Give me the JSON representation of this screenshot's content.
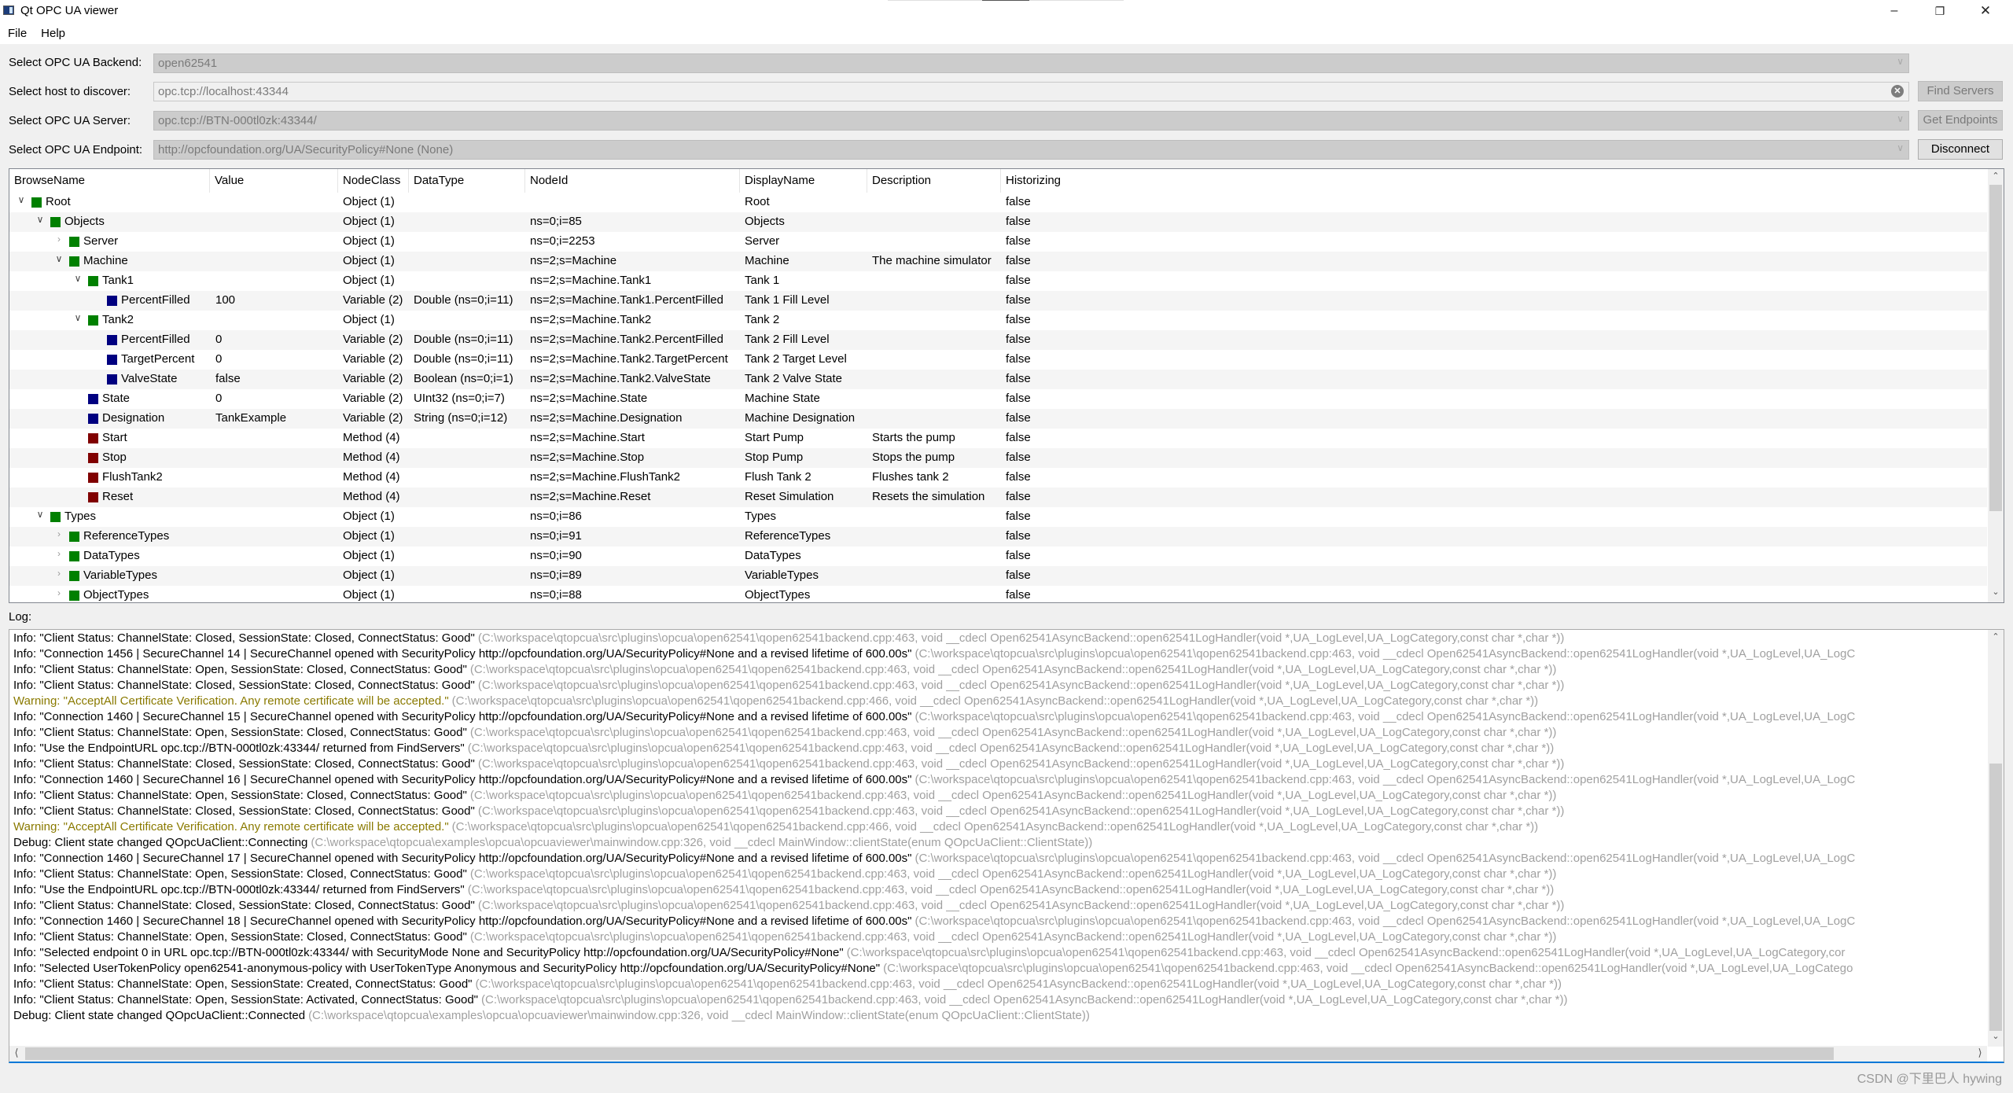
{
  "window": {
    "title": "Qt OPC UA viewer",
    "controls": {
      "minimize": "–",
      "maximize": "❐",
      "close": "✕"
    }
  },
  "menu": [
    "File",
    "Help"
  ],
  "form": {
    "backend": {
      "label": "Select OPC UA Backend:",
      "value": "open62541"
    },
    "host": {
      "label": "Select host to discover:",
      "value": "opc.tcp://localhost:43344"
    },
    "server": {
      "label": "Select OPC UA Server:",
      "value": "opc.tcp://BTN-000tl0zk:43344/"
    },
    "endpoint": {
      "label": "Select OPC UA Endpoint:",
      "value": "http://opcfoundation.org/UA/SecurityPolicy#None (None)"
    },
    "buttons": {
      "find_servers": "Find Servers",
      "get_endpoints": "Get Endpoints",
      "disconnect": "Disconnect"
    }
  },
  "colors": {
    "object_icon": "#008000",
    "variable_icon": "#000080",
    "method_icon": "#800000",
    "warning_text": "#8a7a00",
    "source_text": "#a0a0a0",
    "accent": "#0078d7"
  },
  "tree": {
    "columns": [
      "BrowseName",
      "Value",
      "NodeClass",
      "DataType",
      "NodeId",
      "DisplayName",
      "Description",
      "Historizing"
    ],
    "scroll_position": 0.0,
    "rows": [
      {
        "depth": 0,
        "expander": "expanded",
        "icon": "object",
        "browse_name": "Root",
        "value": "",
        "node_class": "Object (1)",
        "data_type": "",
        "node_id": "",
        "display_name": "Root",
        "description": "",
        "historizing": "false"
      },
      {
        "depth": 1,
        "expander": "expanded",
        "icon": "object",
        "browse_name": "Objects",
        "value": "",
        "node_class": "Object (1)",
        "data_type": "",
        "node_id": "ns=0;i=85",
        "display_name": "Objects",
        "description": "",
        "historizing": "false"
      },
      {
        "depth": 2,
        "expander": "collapsed",
        "icon": "object",
        "browse_name": "Server",
        "value": "",
        "node_class": "Object (1)",
        "data_type": "",
        "node_id": "ns=0;i=2253",
        "display_name": "Server",
        "description": "",
        "historizing": "false"
      },
      {
        "depth": 2,
        "expander": "expanded",
        "icon": "object",
        "browse_name": "Machine",
        "value": "",
        "node_class": "Object (1)",
        "data_type": "",
        "node_id": "ns=2;s=Machine",
        "display_name": "Machine",
        "description": "The machine simulator",
        "historizing": "false"
      },
      {
        "depth": 3,
        "expander": "expanded",
        "icon": "object",
        "browse_name": "Tank1",
        "value": "",
        "node_class": "Object (1)",
        "data_type": "",
        "node_id": "ns=2;s=Machine.Tank1",
        "display_name": "Tank 1",
        "description": "",
        "historizing": "false"
      },
      {
        "depth": 4,
        "expander": "none",
        "icon": "variable",
        "browse_name": "PercentFilled",
        "value": "100",
        "node_class": "Variable (2)",
        "data_type": "Double (ns=0;i=11)",
        "node_id": "ns=2;s=Machine.Tank1.PercentFilled",
        "display_name": "Tank 1 Fill Level",
        "description": "",
        "historizing": "false"
      },
      {
        "depth": 3,
        "expander": "expanded",
        "icon": "object",
        "browse_name": "Tank2",
        "value": "",
        "node_class": "Object (1)",
        "data_type": "",
        "node_id": "ns=2;s=Machine.Tank2",
        "display_name": "Tank 2",
        "description": "",
        "historizing": "false"
      },
      {
        "depth": 4,
        "expander": "none",
        "icon": "variable",
        "browse_name": "PercentFilled",
        "value": "0",
        "node_class": "Variable (2)",
        "data_type": "Double (ns=0;i=11)",
        "node_id": "ns=2;s=Machine.Tank2.PercentFilled",
        "display_name": "Tank 2 Fill Level",
        "description": "",
        "historizing": "false"
      },
      {
        "depth": 4,
        "expander": "none",
        "icon": "variable",
        "browse_name": "TargetPercent",
        "value": "0",
        "node_class": "Variable (2)",
        "data_type": "Double (ns=0;i=11)",
        "node_id": "ns=2;s=Machine.Tank2.TargetPercent",
        "display_name": "Tank 2 Target Level",
        "description": "",
        "historizing": "false"
      },
      {
        "depth": 4,
        "expander": "none",
        "icon": "variable",
        "browse_name": "ValveState",
        "value": "false",
        "node_class": "Variable (2)",
        "data_type": "Boolean (ns=0;i=1)",
        "node_id": "ns=2;s=Machine.Tank2.ValveState",
        "display_name": "Tank 2 Valve State",
        "description": "",
        "historizing": "false"
      },
      {
        "depth": 3,
        "expander": "none",
        "icon": "variable",
        "browse_name": "State",
        "value": "0",
        "node_class": "Variable (2)",
        "data_type": "UInt32 (ns=0;i=7)",
        "node_id": "ns=2;s=Machine.State",
        "display_name": "Machine State",
        "description": "",
        "historizing": "false"
      },
      {
        "depth": 3,
        "expander": "none",
        "icon": "variable",
        "browse_name": "Designation",
        "value": "TankExample",
        "node_class": "Variable (2)",
        "data_type": "String (ns=0;i=12)",
        "node_id": "ns=2;s=Machine.Designation",
        "display_name": "Machine Designation",
        "description": "",
        "historizing": "false"
      },
      {
        "depth": 3,
        "expander": "none",
        "icon": "method",
        "browse_name": "Start",
        "value": "",
        "node_class": "Method (4)",
        "data_type": "",
        "node_id": "ns=2;s=Machine.Start",
        "display_name": "Start Pump",
        "description": "Starts the pump",
        "historizing": "false"
      },
      {
        "depth": 3,
        "expander": "none",
        "icon": "method",
        "browse_name": "Stop",
        "value": "",
        "node_class": "Method (4)",
        "data_type": "",
        "node_id": "ns=2;s=Machine.Stop",
        "display_name": "Stop Pump",
        "description": "Stops the pump",
        "historizing": "false"
      },
      {
        "depth": 3,
        "expander": "none",
        "icon": "method",
        "browse_name": "FlushTank2",
        "value": "",
        "node_class": "Method (4)",
        "data_type": "",
        "node_id": "ns=2;s=Machine.FlushTank2",
        "display_name": "Flush Tank 2",
        "description": "Flushes tank 2",
        "historizing": "false"
      },
      {
        "depth": 3,
        "expander": "none",
        "icon": "method",
        "browse_name": "Reset",
        "value": "",
        "node_class": "Method (4)",
        "data_type": "",
        "node_id": "ns=2;s=Machine.Reset",
        "display_name": "Reset Simulation",
        "description": "Resets the simulation",
        "historizing": "false"
      },
      {
        "depth": 1,
        "expander": "expanded",
        "icon": "object",
        "browse_name": "Types",
        "value": "",
        "node_class": "Object (1)",
        "data_type": "",
        "node_id": "ns=0;i=86",
        "display_name": "Types",
        "description": "",
        "historizing": "false"
      },
      {
        "depth": 2,
        "expander": "collapsed",
        "icon": "object",
        "browse_name": "ReferenceTypes",
        "value": "",
        "node_class": "Object (1)",
        "data_type": "",
        "node_id": "ns=0;i=91",
        "display_name": "ReferenceTypes",
        "description": "",
        "historizing": "false"
      },
      {
        "depth": 2,
        "expander": "collapsed",
        "icon": "object",
        "browse_name": "DataTypes",
        "value": "",
        "node_class": "Object (1)",
        "data_type": "",
        "node_id": "ns=0;i=90",
        "display_name": "DataTypes",
        "description": "",
        "historizing": "false"
      },
      {
        "depth": 2,
        "expander": "collapsed",
        "icon": "object",
        "browse_name": "VariableTypes",
        "value": "",
        "node_class": "Object (1)",
        "data_type": "",
        "node_id": "ns=0;i=89",
        "display_name": "VariableTypes",
        "description": "",
        "historizing": "false"
      },
      {
        "depth": 2,
        "expander": "collapsed",
        "icon": "object",
        "browse_name": "ObjectTypes",
        "value": "",
        "node_class": "Object (1)",
        "data_type": "",
        "node_id": "ns=0;i=88",
        "display_name": "ObjectTypes",
        "description": "",
        "historizing": "false"
      }
    ]
  },
  "log": {
    "label": "Log:",
    "lines": [
      {
        "level": "info",
        "msg": "Info: \"Client Status: ChannelState: Closed, SessionState: Closed, ConnectStatus: Good\"",
        "src": "(C:\\workspace\\qtopcua\\src\\plugins\\opcua\\open62541\\qopen62541backend.cpp:463, void __cdecl Open62541AsyncBackend::open62541LogHandler(void *,UA_LogLevel,UA_LogCategory,const char *,char *))"
      },
      {
        "level": "info",
        "msg": "Info: \"Connection 1456 | SecureChannel 14 | SecureChannel opened with SecurityPolicy http://opcfoundation.org/UA/SecurityPolicy#None and a revised lifetime of 600.00s\"",
        "src": "(C:\\workspace\\qtopcua\\src\\plugins\\opcua\\open62541\\qopen62541backend.cpp:463, void __cdecl Open62541AsyncBackend::open62541LogHandler(void *,UA_LogLevel,UA_LogC"
      },
      {
        "level": "info",
        "msg": "Info: \"Client Status: ChannelState: Open, SessionState: Closed, ConnectStatus: Good\"",
        "src": "(C:\\workspace\\qtopcua\\src\\plugins\\opcua\\open62541\\qopen62541backend.cpp:463, void __cdecl Open62541AsyncBackend::open62541LogHandler(void *,UA_LogLevel,UA_LogCategory,const char *,char *))"
      },
      {
        "level": "info",
        "msg": "Info: \"Client Status: ChannelState: Closed, SessionState: Closed, ConnectStatus: Good\"",
        "src": "(C:\\workspace\\qtopcua\\src\\plugins\\opcua\\open62541\\qopen62541backend.cpp:463, void __cdecl Open62541AsyncBackend::open62541LogHandler(void *,UA_LogLevel,UA_LogCategory,const char *,char *))"
      },
      {
        "level": "warning",
        "msg": "Warning: \"AcceptAll Certificate Verification. Any remote certificate will be accepted.\"",
        "src": "(C:\\workspace\\qtopcua\\src\\plugins\\opcua\\open62541\\qopen62541backend.cpp:466, void __cdecl Open62541AsyncBackend::open62541LogHandler(void *,UA_LogLevel,UA_LogCategory,const char *,char *))"
      },
      {
        "level": "info",
        "msg": "Info: \"Connection 1460 | SecureChannel 15 | SecureChannel opened with SecurityPolicy http://opcfoundation.org/UA/SecurityPolicy#None and a revised lifetime of 600.00s\"",
        "src": "(C:\\workspace\\qtopcua\\src\\plugins\\opcua\\open62541\\qopen62541backend.cpp:463, void __cdecl Open62541AsyncBackend::open62541LogHandler(void *,UA_LogLevel,UA_LogC"
      },
      {
        "level": "info",
        "msg": "Info: \"Client Status: ChannelState: Open, SessionState: Closed, ConnectStatus: Good\"",
        "src": "(C:\\workspace\\qtopcua\\src\\plugins\\opcua\\open62541\\qopen62541backend.cpp:463, void __cdecl Open62541AsyncBackend::open62541LogHandler(void *,UA_LogLevel,UA_LogCategory,const char *,char *))"
      },
      {
        "level": "info",
        "msg": "Info: \"Use the EndpointURL opc.tcp://BTN-000tl0zk:43344/ returned from FindServers\"",
        "src": "(C:\\workspace\\qtopcua\\src\\plugins\\opcua\\open62541\\qopen62541backend.cpp:463, void __cdecl Open62541AsyncBackend::open62541LogHandler(void *,UA_LogLevel,UA_LogCategory,const char *,char *))"
      },
      {
        "level": "info",
        "msg": "Info: \"Client Status: ChannelState: Closed, SessionState: Closed, ConnectStatus: Good\"",
        "src": "(C:\\workspace\\qtopcua\\src\\plugins\\opcua\\open62541\\qopen62541backend.cpp:463, void __cdecl Open62541AsyncBackend::open62541LogHandler(void *,UA_LogLevel,UA_LogCategory,const char *,char *))"
      },
      {
        "level": "info",
        "msg": "Info: \"Connection 1460 | SecureChannel 16 | SecureChannel opened with SecurityPolicy http://opcfoundation.org/UA/SecurityPolicy#None and a revised lifetime of 600.00s\"",
        "src": "(C:\\workspace\\qtopcua\\src\\plugins\\opcua\\open62541\\qopen62541backend.cpp:463, void __cdecl Open62541AsyncBackend::open62541LogHandler(void *,UA_LogLevel,UA_LogC"
      },
      {
        "level": "info",
        "msg": "Info: \"Client Status: ChannelState: Open, SessionState: Closed, ConnectStatus: Good\"",
        "src": "(C:\\workspace\\qtopcua\\src\\plugins\\opcua\\open62541\\qopen62541backend.cpp:463, void __cdecl Open62541AsyncBackend::open62541LogHandler(void *,UA_LogLevel,UA_LogCategory,const char *,char *))"
      },
      {
        "level": "info",
        "msg": "Info: \"Client Status: ChannelState: Closed, SessionState: Closed, ConnectStatus: Good\"",
        "src": "(C:\\workspace\\qtopcua\\src\\plugins\\opcua\\open62541\\qopen62541backend.cpp:463, void __cdecl Open62541AsyncBackend::open62541LogHandler(void *,UA_LogLevel,UA_LogCategory,const char *,char *))"
      },
      {
        "level": "warning",
        "msg": "Warning: \"AcceptAll Certificate Verification. Any remote certificate will be accepted.\"",
        "src": "(C:\\workspace\\qtopcua\\src\\plugins\\opcua\\open62541\\qopen62541backend.cpp:466, void __cdecl Open62541AsyncBackend::open62541LogHandler(void *,UA_LogLevel,UA_LogCategory,const char *,char *))"
      },
      {
        "level": "debug",
        "msg": "Debug: Client state changed QOpcUaClient::Connecting",
        "src": "(C:\\workspace\\qtopcua\\examples\\opcua\\opcuaviewer\\mainwindow.cpp:326, void __cdecl MainWindow::clientState(enum QOpcUaClient::ClientState))"
      },
      {
        "level": "info",
        "msg": "Info: \"Connection 1460 | SecureChannel 17 | SecureChannel opened with SecurityPolicy http://opcfoundation.org/UA/SecurityPolicy#None and a revised lifetime of 600.00s\"",
        "src": "(C:\\workspace\\qtopcua\\src\\plugins\\opcua\\open62541\\qopen62541backend.cpp:463, void __cdecl Open62541AsyncBackend::open62541LogHandler(void *,UA_LogLevel,UA_LogC"
      },
      {
        "level": "info",
        "msg": "Info: \"Client Status: ChannelState: Open, SessionState: Closed, ConnectStatus: Good\"",
        "src": "(C:\\workspace\\qtopcua\\src\\plugins\\opcua\\open62541\\qopen62541backend.cpp:463, void __cdecl Open62541AsyncBackend::open62541LogHandler(void *,UA_LogLevel,UA_LogCategory,const char *,char *))"
      },
      {
        "level": "info",
        "msg": "Info: \"Use the EndpointURL opc.tcp://BTN-000tl0zk:43344/ returned from FindServers\"",
        "src": "(C:\\workspace\\qtopcua\\src\\plugins\\opcua\\open62541\\qopen62541backend.cpp:463, void __cdecl Open62541AsyncBackend::open62541LogHandler(void *,UA_LogLevel,UA_LogCategory,const char *,char *))"
      },
      {
        "level": "info",
        "msg": "Info: \"Client Status: ChannelState: Closed, SessionState: Closed, ConnectStatus: Good\"",
        "src": "(C:\\workspace\\qtopcua\\src\\plugins\\opcua\\open62541\\qopen62541backend.cpp:463, void __cdecl Open62541AsyncBackend::open62541LogHandler(void *,UA_LogLevel,UA_LogCategory,const char *,char *))"
      },
      {
        "level": "info",
        "msg": "Info: \"Connection 1460 | SecureChannel 18 | SecureChannel opened with SecurityPolicy http://opcfoundation.org/UA/SecurityPolicy#None and a revised lifetime of 600.00s\"",
        "src": "(C:\\workspace\\qtopcua\\src\\plugins\\opcua\\open62541\\qopen62541backend.cpp:463, void __cdecl Open62541AsyncBackend::open62541LogHandler(void *,UA_LogLevel,UA_LogC"
      },
      {
        "level": "info",
        "msg": "Info: \"Client Status: ChannelState: Open, SessionState: Closed, ConnectStatus: Good\"",
        "src": "(C:\\workspace\\qtopcua\\src\\plugins\\opcua\\open62541\\qopen62541backend.cpp:463, void __cdecl Open62541AsyncBackend::open62541LogHandler(void *,UA_LogLevel,UA_LogCategory,const char *,char *))"
      },
      {
        "level": "info",
        "msg": "Info: \"Selected endpoint 0 in URL opc.tcp://BTN-000tl0zk:43344/ with SecurityMode None and SecurityPolicy http://opcfoundation.org/UA/SecurityPolicy#None\"",
        "src": "(C:\\workspace\\qtopcua\\src\\plugins\\opcua\\open62541\\qopen62541backend.cpp:463, void __cdecl Open62541AsyncBackend::open62541LogHandler(void *,UA_LogLevel,UA_LogCategory,cor"
      },
      {
        "level": "info",
        "msg": "Info: \"Selected UserTokenPolicy open62541-anonymous-policy with UserTokenType Anonymous and SecurityPolicy http://opcfoundation.org/UA/SecurityPolicy#None\"",
        "src": "(C:\\workspace\\qtopcua\\src\\plugins\\opcua\\open62541\\qopen62541backend.cpp:463, void __cdecl Open62541AsyncBackend::open62541LogHandler(void *,UA_LogLevel,UA_LogCatego"
      },
      {
        "level": "info",
        "msg": "Info: \"Client Status: ChannelState: Open, SessionState: Created, ConnectStatus: Good\"",
        "src": "(C:\\workspace\\qtopcua\\src\\plugins\\opcua\\open62541\\qopen62541backend.cpp:463, void __cdecl Open62541AsyncBackend::open62541LogHandler(void *,UA_LogLevel,UA_LogCategory,const char *,char *))"
      },
      {
        "level": "info",
        "msg": "Info: \"Client Status: ChannelState: Open, SessionState: Activated, ConnectStatus: Good\"",
        "src": "(C:\\workspace\\qtopcua\\src\\plugins\\opcua\\open62541\\qopen62541backend.cpp:463, void __cdecl Open62541AsyncBackend::open62541LogHandler(void *,UA_LogLevel,UA_LogCategory,const char *,char *))"
      },
      {
        "level": "debug",
        "msg": "Debug: Client state changed QOpcUaClient::Connected",
        "src": "(C:\\workspace\\qtopcua\\examples\\opcua\\opcuaviewer\\mainwindow.cpp:326, void __cdecl MainWindow::clientState(enum QOpcUaClient::ClientState))"
      }
    ]
  },
  "watermark": "CSDN @下里巴人 hywing"
}
